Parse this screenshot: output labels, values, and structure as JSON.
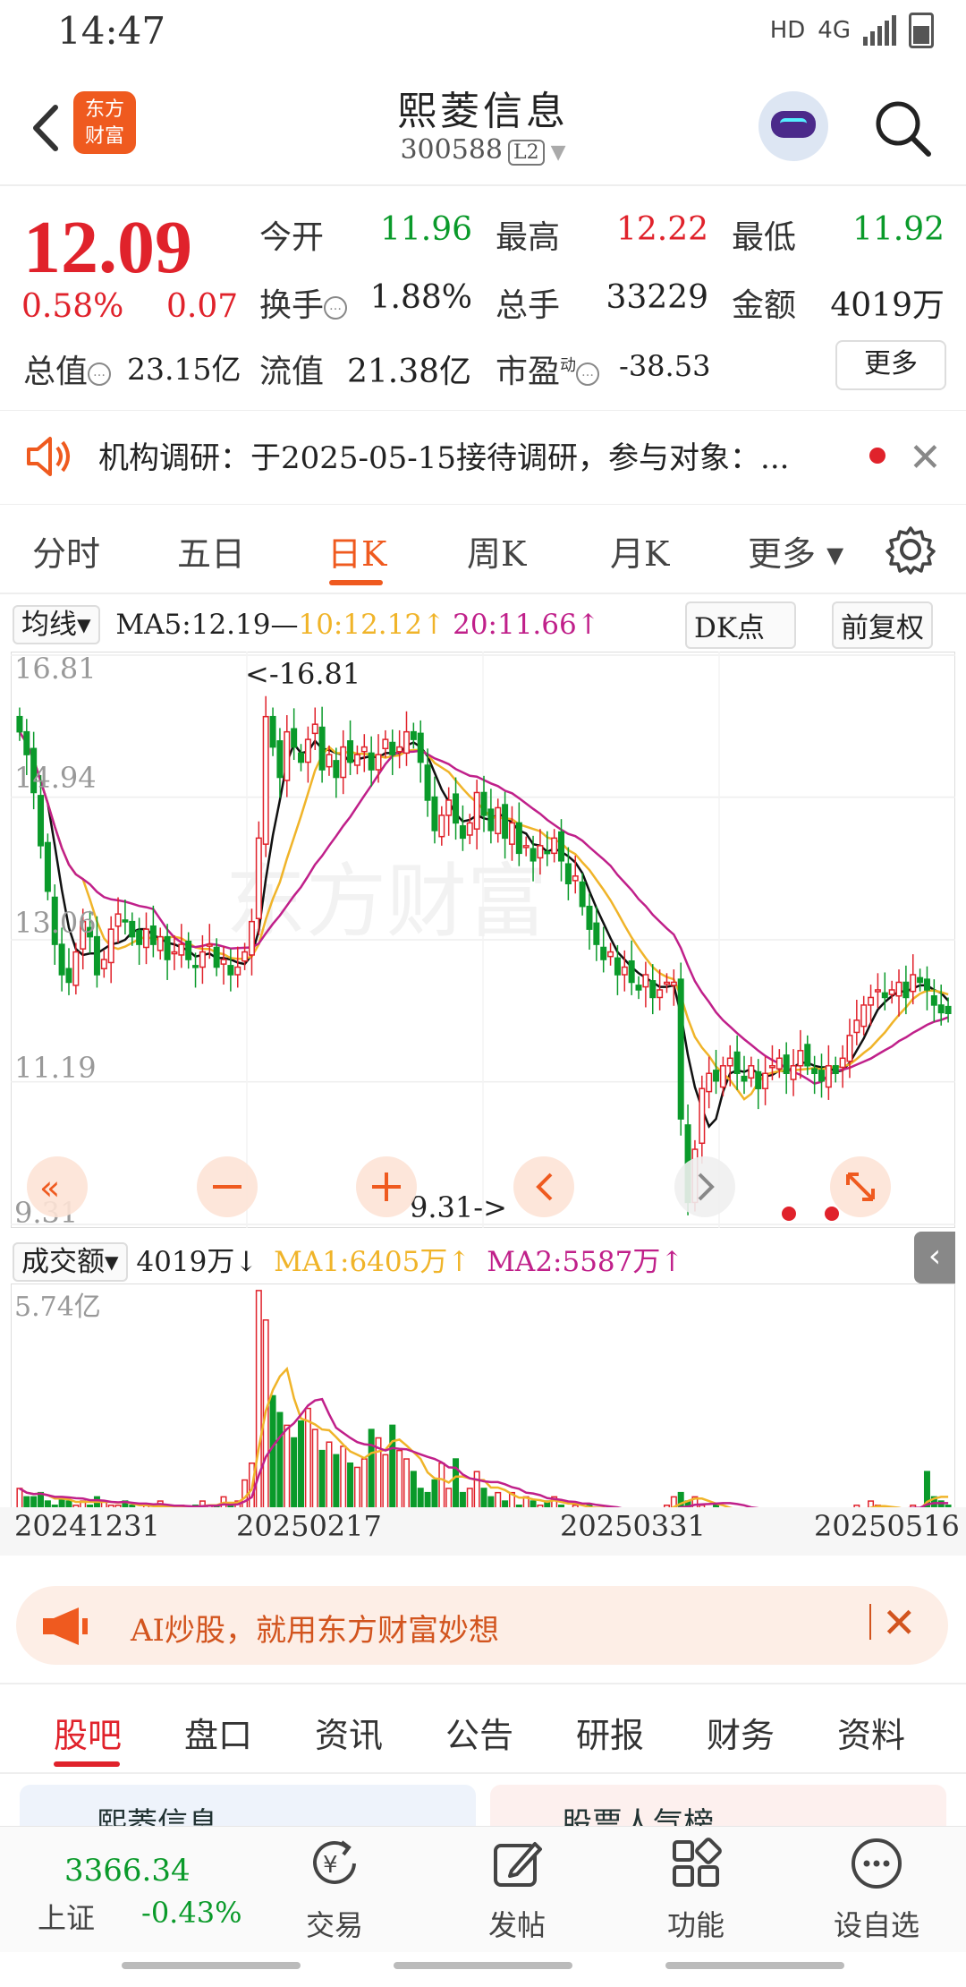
{
  "status_bar": {
    "time": "14:47",
    "hd": "HD",
    "network": "4G"
  },
  "header": {
    "stock_name": "熙菱信息",
    "stock_code": "300588",
    "level_badge": "L2",
    "logo_line1": "东方",
    "logo_line2": "财富"
  },
  "quote": {
    "price": "12.09",
    "change_pct": "0.58%",
    "change_abs": "0.07",
    "open_label": "今开",
    "open": "11.96",
    "high_label": "最高",
    "high": "12.22",
    "low_label": "最低",
    "low": "11.92",
    "turnover_label": "换手",
    "turnover": "1.88%",
    "volume_label": "总手",
    "volume": "33229",
    "amount_label": "金额",
    "amount": "4019万",
    "mktcap_label": "总值",
    "mktcap": "23.15亿",
    "float_label": "流值",
    "float_cap": "21.38亿",
    "pe_label": "市盈",
    "pe_sup": "动",
    "pe": "-38.53",
    "more_label": "更多"
  },
  "notice": {
    "text": "机构调研：于2025-05-15接待调研，参与对象：..."
  },
  "period_tabs": [
    "分时",
    "五日",
    "日K",
    "周K",
    "月K",
    "更多 ▾"
  ],
  "ma_row": {
    "selector": "均线▾",
    "ma5": "MA5:12.19—",
    "ma10": "10:12.12↑",
    "ma20": "20:11.66↑",
    "dk": "DK点",
    "adjust": "前复权"
  },
  "kline_labels": {
    "y_top": "16.81",
    "y2": "14.94",
    "y3": "13.06",
    "y4": "11.19",
    "y_bottom": "9.31",
    "max_marker": "<-16.81",
    "min_marker": "9.31->"
  },
  "volume_row": {
    "selector": "成交额▾",
    "amount": "4019万↓",
    "ma1": "MA1:6405万↑",
    "ma2": "MA2:5587万↑",
    "y_top": "5.74亿"
  },
  "dates": [
    "20241231",
    "20250217",
    "20250331",
    "20250516"
  ],
  "ad": {
    "text": "AI炒股，就用东方财富妙想"
  },
  "content_tabs": [
    "股吧",
    "盘口",
    "资讯",
    "公告",
    "研报",
    "财务",
    "资料"
  ],
  "cards": {
    "left": "熙菱信息",
    "right": "股票人气榜"
  },
  "bottom_bar": {
    "index_value": "3366.34",
    "index_name": "上证",
    "index_change": "-0.43%",
    "items": [
      "交易",
      "发帖",
      "功能",
      "设自选"
    ]
  },
  "colors": {
    "up": "#e0222b",
    "down": "#0a9a2a",
    "ma5": "#111111",
    "ma10": "#f0b429",
    "ma20": "#c0208a",
    "accent": "#ef5a1f"
  },
  "chart_data": [
    {
      "type": "candlestick",
      "title": "日K",
      "ylim": [
        9.31,
        16.81
      ],
      "y_ticks": [
        16.81,
        14.94,
        13.06,
        11.19,
        9.31
      ],
      "x_labels": [
        "20241231",
        "20250217",
        "20250331",
        "20250516"
      ],
      "close": [
        15.8,
        15.5,
        15.0,
        14.3,
        13.7,
        13.0,
        12.6,
        12.5,
        12.9,
        13.3,
        13.1,
        12.6,
        12.8,
        13.2,
        13.4,
        13.3,
        13.1,
        13.0,
        13.2,
        13.0,
        13.1,
        12.8,
        12.9,
        13.0,
        12.8,
        12.7,
        12.9,
        13.0,
        12.7,
        12.8,
        12.6,
        12.7,
        12.9,
        13.3,
        14.4,
        16.0,
        15.6,
        15.2,
        15.8,
        15.6,
        15.4,
        15.7,
        15.9,
        15.3,
        15.5,
        15.2,
        15.6,
        15.4,
        15.5,
        15.6,
        15.3,
        15.5,
        15.7,
        15.5,
        15.6,
        15.8,
        15.7,
        15.4,
        14.9,
        14.5,
        14.7,
        14.9,
        14.6,
        14.4,
        14.6,
        15.0,
        14.7,
        14.5,
        14.8,
        14.4,
        14.6,
        14.2,
        14.3,
        14.1,
        14.3,
        14.2,
        14.4,
        14.1,
        13.8,
        13.9,
        13.5,
        13.2,
        13.0,
        12.8,
        12.9,
        12.6,
        12.7,
        12.5,
        12.4,
        12.6,
        12.3,
        12.4,
        12.5,
        12.5,
        10.7,
        9.6,
        10.3,
        11.1,
        11.3,
        11.2,
        11.4,
        11.5,
        11.3,
        11.2,
        11.4,
        11.1,
        11.3,
        11.4,
        11.5,
        11.3,
        11.4,
        11.6,
        11.4,
        11.3,
        11.2,
        11.4,
        11.3,
        11.5,
        11.8,
        12.0,
        12.2,
        12.3,
        12.4,
        12.3,
        12.4,
        12.5,
        12.3,
        12.6,
        12.5,
        12.4,
        12.2,
        12.1,
        12.09
      ],
      "ma5_last": 12.19,
      "ma10_last": 12.12,
      "ma20_last": 11.66
    },
    {
      "type": "bar",
      "title": "成交额",
      "ylim": [
        0,
        5.74
      ],
      "unit": "亿",
      "values": [
        1.0,
        0.8,
        0.8,
        0.9,
        0.7,
        0.6,
        0.8,
        0.7,
        0.6,
        0.7,
        0.6,
        0.8,
        0.7,
        0.6,
        0.6,
        0.7,
        0.6,
        0.5,
        0.6,
        0.5,
        0.7,
        0.6,
        0.5,
        0.6,
        0.5,
        0.6,
        0.7,
        0.6,
        0.6,
        0.8,
        0.6,
        0.7,
        1.2,
        1.6,
        5.7,
        5.0,
        3.2,
        2.8,
        2.5,
        2.2,
        2.6,
        2.9,
        2.4,
        1.9,
        2.1,
        1.8,
        2.0,
        1.6,
        1.5,
        1.7,
        2.4,
        2.2,
        1.8,
        2.5,
        1.9,
        1.7,
        1.4,
        1.0,
        0.9,
        1.2,
        1.6,
        1.0,
        1.7,
        0.9,
        1.0,
        1.4,
        1.0,
        0.8,
        0.9,
        0.7,
        0.9,
        0.6,
        0.8,
        0.7,
        0.6,
        0.7,
        0.8,
        0.6,
        0.5,
        0.6,
        0.5,
        0.6,
        0.5,
        0.5,
        0.4,
        0.5,
        0.4,
        0.5,
        0.4,
        0.5,
        0.4,
        0.5,
        0.6,
        0.8,
        0.9,
        0.7,
        0.8,
        0.6,
        0.5,
        0.6,
        0.5,
        0.5,
        0.4,
        0.5,
        0.4,
        0.5,
        0.4,
        0.4,
        0.5,
        0.4,
        0.4,
        0.5,
        0.4,
        0.4,
        0.4,
        0.5,
        0.4,
        0.4,
        0.5,
        0.6,
        0.5,
        0.7,
        0.6,
        0.5,
        0.5,
        0.4,
        0.5,
        0.6,
        0.5,
        1.4,
        0.8,
        0.7,
        0.6
      ],
      "ma1_last": "6405万",
      "ma2_last": "5587万"
    }
  ]
}
